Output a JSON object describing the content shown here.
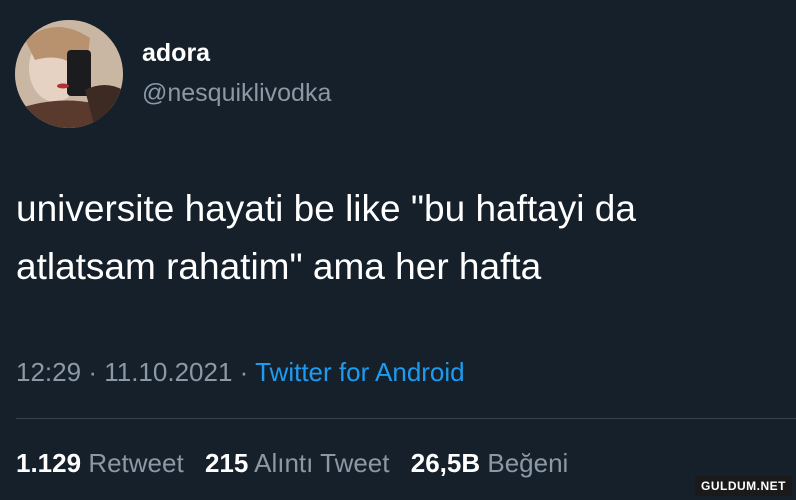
{
  "user": {
    "display_name": "adora",
    "handle": "@nesquiklivodka",
    "avatar": "avatar-photo"
  },
  "tweet": {
    "lines": [
      "universite hayati be like \"bu haftayi da",
      "atlatsam rahatim\" ama her hafta"
    ]
  },
  "meta": {
    "time": "12:29",
    "separator": "·",
    "date": "11.10.2021",
    "source": "Twitter for Android"
  },
  "stats": {
    "retweets_count": "1.129",
    "retweets_label": "Retweet",
    "quotes_count": "215",
    "quotes_label": "Alıntı Tweet",
    "likes_count": "26,5B",
    "likes_label": "Beğeni"
  },
  "watermark": "GULDUM.NET",
  "colors": {
    "background": "#15202b",
    "text": "#ffffff",
    "secondary": "#8b98a5",
    "link": "#1d9bf0",
    "divider": "#38444d"
  }
}
